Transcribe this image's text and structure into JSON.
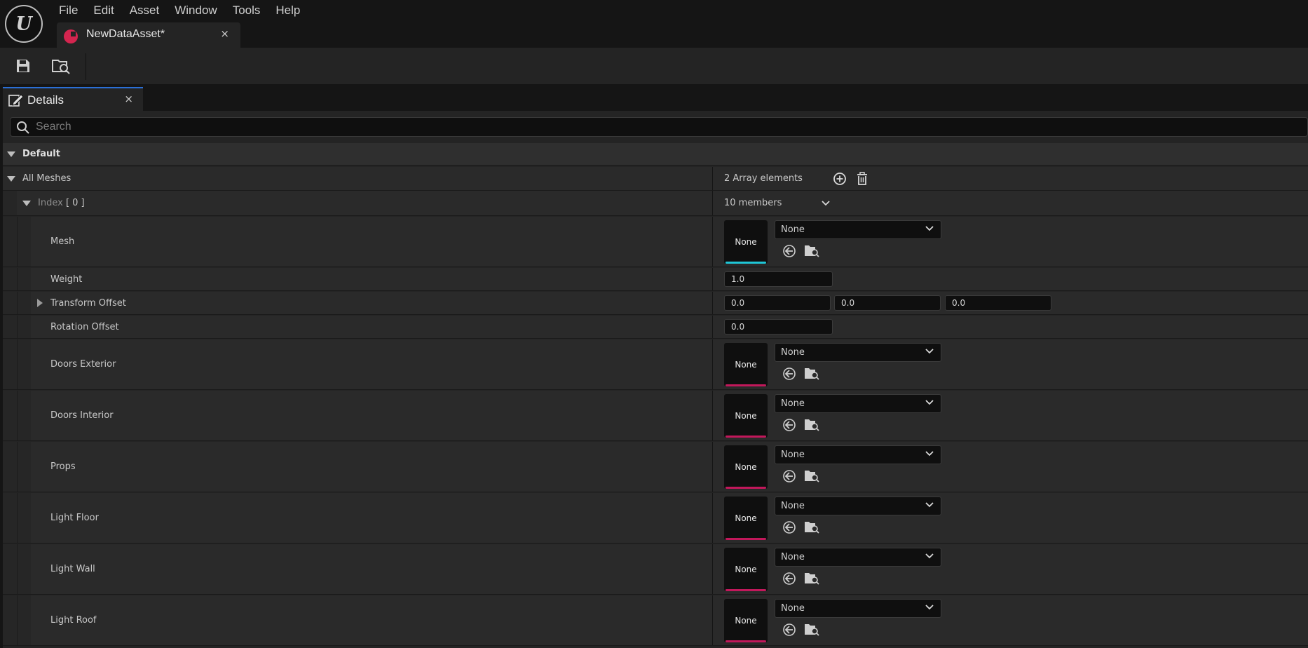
{
  "app": {
    "logo_letter": "U"
  },
  "menu": [
    "File",
    "Edit",
    "Asset",
    "Window",
    "Tools",
    "Help"
  ],
  "document_tab": {
    "label": "NewDataAsset*",
    "close": "×"
  },
  "toolbar": {
    "save_icon": "save-icon",
    "browse_icon": "browse-to-asset-icon"
  },
  "details": {
    "tab_label": "Details",
    "close": "×",
    "search_placeholder": "Search"
  },
  "category": {
    "label": "Default"
  },
  "all_meshes": {
    "label": "All Meshes",
    "value": "2 Array elements"
  },
  "index0": {
    "label": "Index",
    "index": "[ 0 ]",
    "value": "10 members"
  },
  "properties": {
    "mesh": {
      "label": "Mesh",
      "thumb": "None",
      "combo": "None",
      "accent": "#1fc6d6"
    },
    "weight": {
      "label": "Weight",
      "value": "1.0"
    },
    "transform_offset": {
      "label": "Transform Offset",
      "x": "0.0",
      "y": "0.0",
      "z": "0.0"
    },
    "rotation_offset": {
      "label": "Rotation Offset",
      "value": "0.0"
    },
    "doors_exterior": {
      "label": "Doors Exterior",
      "thumb": "None",
      "combo": "None",
      "accent": "#c2185b"
    },
    "doors_interior": {
      "label": "Doors Interior",
      "thumb": "None",
      "combo": "None",
      "accent": "#c2185b"
    },
    "props": {
      "label": "Props",
      "thumb": "None",
      "combo": "None",
      "accent": "#c2185b"
    },
    "light_floor": {
      "label": "Light Floor",
      "thumb": "None",
      "combo": "None",
      "accent": "#c2185b"
    },
    "light_wall": {
      "label": "Light Wall",
      "thumb": "None",
      "combo": "None",
      "accent": "#c2185b"
    },
    "light_roof": {
      "label": "Light Roof",
      "thumb": "None",
      "combo": "None",
      "accent": "#c2185b"
    }
  }
}
